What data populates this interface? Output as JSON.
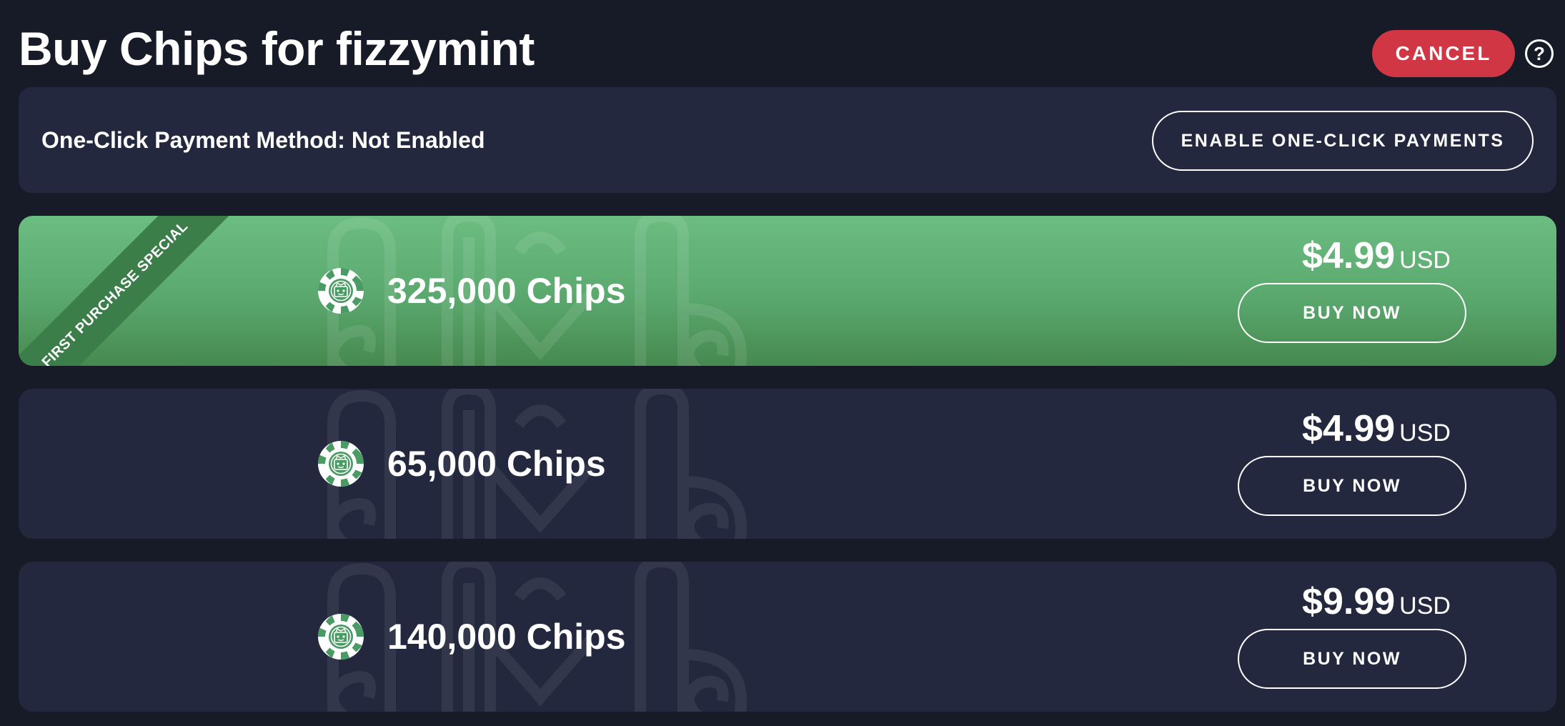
{
  "header": {
    "title": "Buy Chips for fizzymint",
    "cancel_label": "CANCEL",
    "help_label": "?"
  },
  "payment": {
    "label": "One-Click Payment Method: Not Enabled",
    "enable_label": "ENABLE ONE-CLICK PAYMENTS"
  },
  "offers": [
    {
      "badge": "First Purchase Special",
      "chips": "325,000 Chips",
      "price": "$4.99",
      "currency": "USD",
      "buy_label": "BUY NOW"
    },
    {
      "chips": "65,000 Chips",
      "price": "$4.99",
      "currency": "USD",
      "buy_label": "BUY NOW"
    },
    {
      "chips": "140,000 Chips",
      "price": "$9.99",
      "currency": "USD",
      "buy_label": "BUY NOW"
    }
  ],
  "colors": {
    "background": "#161b27",
    "panel": "#23283e",
    "cancel": "#d03644",
    "featured_top": "#6cbd82",
    "featured_bottom": "#46894f",
    "ribbon": "#3c7e4a",
    "chip": "#4a9a63"
  },
  "icons": {
    "help": "question-circle-icon",
    "chip": "poker-chip-icon"
  }
}
